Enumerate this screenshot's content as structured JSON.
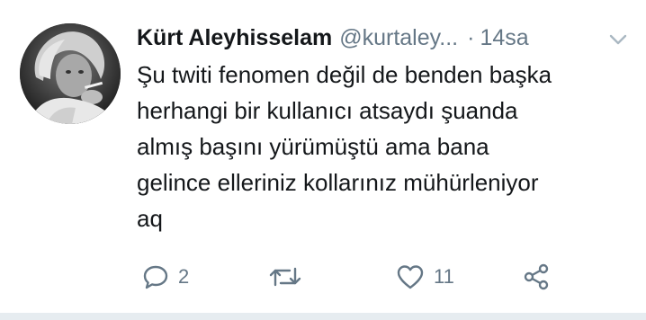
{
  "tweet": {
    "display_name": "Kürt Aleyhisselam",
    "handle": "@kurtaley...",
    "separator": "·",
    "time": "14sa",
    "text": "Şu twiti fenomen değil de benden başka\nherhangi bir kullanıcı atsaydı şuanda\nalmış başını yürümüştü ama bana\ngelince elleriniz kollarınız mühürleniyor\naq"
  },
  "actions": {
    "reply_count": "2",
    "retweet_count": "",
    "like_count": "11"
  },
  "icons": {
    "reply": "reply-icon",
    "retweet": "retweet-icon",
    "like": "heart-icon",
    "share": "share-icon",
    "caret": "chevron-down-icon"
  },
  "colors": {
    "text": "#14171a",
    "secondary": "#657786",
    "divider": "#e6ecf0"
  }
}
